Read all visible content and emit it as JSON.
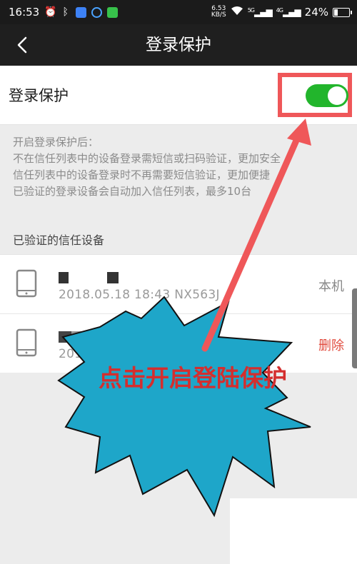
{
  "status_bar": {
    "time": "16:53",
    "net_speed_value": "6.53",
    "net_speed_unit": "KB/S",
    "signal_1": "5G",
    "signal_2": "4G",
    "battery": "24%"
  },
  "header": {
    "title": "登录保护"
  },
  "protection": {
    "label": "登录保护",
    "toggle_on": true
  },
  "info": {
    "heading": "开启登录保护后：",
    "line1": "不在信任列表中的设备登录需短信或扫码验证，更加安全",
    "line2": "信任列表中的设备登录时不再需要短信验证，更加便捷",
    "line3": "已验证的登录设备会自动加入信任列表，最多10台"
  },
  "devices": {
    "section_title": "已验证的信任设备",
    "items": [
      {
        "meta": "2018.05.18  18:43   NX563J",
        "action": "本机"
      },
      {
        "meta": "2018.0",
        "action": "删除"
      }
    ]
  },
  "annotation": {
    "text": "点击开启登陆保护"
  },
  "colors": {
    "toggle_on": "#22b52c",
    "highlight": "#ef5759",
    "burst_fill": "#1ea6c9",
    "annotation_text": "#d42e2e",
    "delete": "#e14b3e"
  }
}
